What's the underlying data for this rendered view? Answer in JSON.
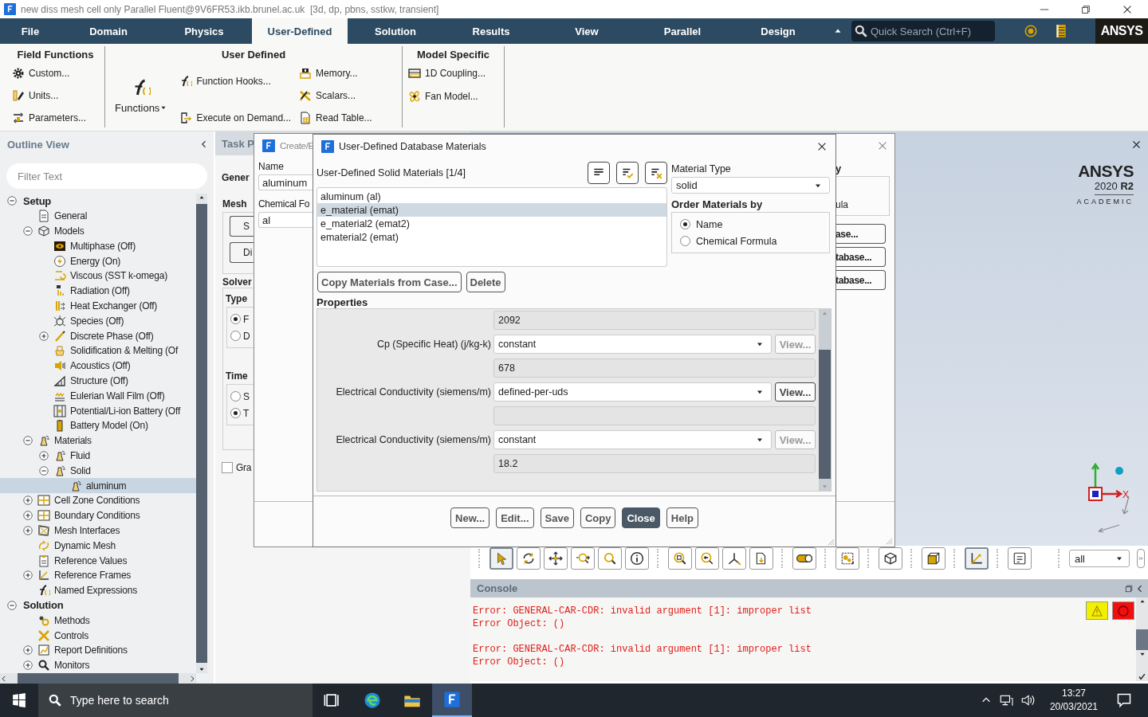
{
  "window": {
    "title": "new diss mesh cell only Parallel Fluent@9V6FR53.ikb.brunel.ac.uk  [3d, dp, pbns, sstkw, transient]"
  },
  "ribbon_tabs": [
    {
      "label": "File",
      "selected": false
    },
    {
      "label": "Domain",
      "selected": false
    },
    {
      "label": "Physics",
      "selected": false
    },
    {
      "label": "User-Defined",
      "selected": true
    },
    {
      "label": "Solution",
      "selected": false
    },
    {
      "label": "Results",
      "selected": false
    },
    {
      "label": "View",
      "selected": false
    },
    {
      "label": "Parallel",
      "selected": false
    },
    {
      "label": "Design",
      "selected": false
    }
  ],
  "quick_search": {
    "placeholder": "Quick Search (Ctrl+F)"
  },
  "brand": "ANSYS",
  "ribbon_groups": [
    {
      "title": "Field Functions",
      "columns": [
        [
          {
            "kind": "small",
            "label": "Custom..."
          },
          {
            "kind": "small",
            "label": "Units..."
          },
          {
            "kind": "small",
            "label": "Parameters..."
          }
        ]
      ]
    },
    {
      "title": "User Defined",
      "columns": [
        [
          {
            "kind": "large",
            "label": "Functions"
          }
        ],
        [
          {
            "kind": "small",
            "label": "Function Hooks..."
          },
          {
            "kind": "small",
            "label": "Execute on Demand..."
          }
        ],
        [
          {
            "kind": "small",
            "label": "Memory..."
          },
          {
            "kind": "small",
            "label": "Scalars..."
          },
          {
            "kind": "small",
            "label": "Read Table..."
          }
        ]
      ]
    },
    {
      "title": "Model Specific",
      "columns": [
        [
          {
            "kind": "small",
            "label": "1D Coupling..."
          },
          {
            "kind": "small",
            "label": "Fan Model..."
          }
        ]
      ]
    }
  ],
  "outline": {
    "title": "Outline View",
    "filter_placeholder": "Filter Text",
    "tree": [
      {
        "label": "Setup",
        "expanded": true,
        "selected": false,
        "children": [
          {
            "label": "General",
            "selected": false
          },
          {
            "label": "Models",
            "expanded": true,
            "selected": false,
            "children": [
              {
                "label": "Multiphase (Off)",
                "selected": false
              },
              {
                "label": "Energy (On)",
                "selected": false
              },
              {
                "label": "Viscous (SST k-omega)",
                "selected": false
              },
              {
                "label": "Radiation (Off)",
                "selected": false
              },
              {
                "label": "Heat Exchanger (Off)",
                "selected": false
              },
              {
                "label": "Species (Off)",
                "selected": false
              },
              {
                "label": "Discrete Phase (Off)",
                "expanded": false,
                "selected": false
              },
              {
                "label": "Solidification & Melting (Of",
                "selected": false
              },
              {
                "label": "Acoustics (Off)",
                "selected": false
              },
              {
                "label": "Structure (Off)",
                "selected": false
              },
              {
                "label": "Eulerian Wall Film (Off)",
                "selected": false
              },
              {
                "label": "Potential/Li-ion Battery (Off",
                "selected": false
              },
              {
                "label": "Battery Model (On)",
                "selected": false
              }
            ]
          },
          {
            "label": "Materials",
            "expanded": true,
            "selected": false,
            "children": [
              {
                "label": "Fluid",
                "expanded": false,
                "selected": false
              },
              {
                "label": "Solid",
                "expanded": true,
                "selected": false,
                "children": [
                  {
                    "label": "aluminum",
                    "selected": true
                  }
                ]
              }
            ]
          },
          {
            "label": "Cell Zone Conditions",
            "expanded": false,
            "selected": false
          },
          {
            "label": "Boundary Conditions",
            "expanded": false,
            "selected": false
          },
          {
            "label": "Mesh Interfaces",
            "expanded": false,
            "selected": false
          },
          {
            "label": "Dynamic Mesh",
            "selected": false
          },
          {
            "label": "Reference Values",
            "selected": false
          },
          {
            "label": "Reference Frames",
            "expanded": false,
            "selected": false
          },
          {
            "label": "Named Expressions",
            "selected": false
          }
        ]
      },
      {
        "label": "Solution",
        "expanded": true,
        "selected": false,
        "children": [
          {
            "label": "Methods",
            "selected": false
          },
          {
            "label": "Controls",
            "selected": false
          },
          {
            "label": "Report Definitions",
            "expanded": false,
            "selected": false
          },
          {
            "label": "Monitors",
            "expanded": false,
            "selected": false
          }
        ]
      }
    ]
  },
  "task_page": {
    "title": "Task P",
    "general": "Gener",
    "mesh": {
      "label": "Mesh",
      "buttons": [
        "S",
        "Di"
      ]
    },
    "solver": {
      "label": "Solver",
      "type": {
        "label": "Type",
        "options": [
          {
            "label": "F",
            "selected": true
          },
          {
            "label": "D",
            "selected": false
          }
        ]
      },
      "time": {
        "label": "Time",
        "options": [
          {
            "label": "S",
            "selected": false
          },
          {
            "label": "T",
            "selected": true
          }
        ]
      }
    },
    "gravity": {
      "label": "Gra",
      "checked": false
    }
  },
  "edit_dialog": {
    "title": "Create/E",
    "name_label": "Name",
    "name_value": "aluminum",
    "formula_label": "Chemical Fo",
    "formula_value": "al",
    "order_label": "y",
    "order_option": "ula",
    "buttons": [
      "ase...",
      "tabase...",
      "tabase..."
    ]
  },
  "database_dialog": {
    "title": "User-Defined Database Materials",
    "list_label": "User-Defined Solid Materials [1/4]",
    "materials": [
      {
        "label": "aluminum (al)",
        "selected": false
      },
      {
        "label": "e_material (emat)",
        "selected": true
      },
      {
        "label": "e_material2 (emat2)",
        "selected": false
      },
      {
        "label": "ematerial2 (emat)",
        "selected": false
      }
    ],
    "material_type": {
      "label": "Material Type",
      "value": "solid"
    },
    "order_by": {
      "label": "Order Materials by",
      "options": [
        {
          "label": "Name",
          "selected": true
        },
        {
          "label": "Chemical Formula",
          "selected": false
        }
      ]
    },
    "list_buttons": [
      "Copy Materials from Case...",
      "Delete"
    ],
    "properties_label": "Properties",
    "properties": [
      {
        "kind": "value",
        "value": "2092"
      },
      {
        "kind": "method",
        "label": "Cp (Specific Heat) (j/kg-k)",
        "value": "constant",
        "button": "View...",
        "disabled": true
      },
      {
        "kind": "value",
        "value": "678"
      },
      {
        "kind": "method",
        "label": "Electrical Conductivity (siemens/m)",
        "value": "defined-per-uds",
        "button": "View...",
        "disabled": false
      },
      {
        "kind": "value"
      },
      {
        "kind": "method",
        "label": "Electrical Conductivity (siemens/m)",
        "value": "constant",
        "button": "View...",
        "disabled": true
      },
      {
        "kind": "value",
        "value": "18.2"
      }
    ],
    "buttons": [
      {
        "label": "New...",
        "default": false
      },
      {
        "label": "Edit...",
        "default": false
      },
      {
        "label": "Save",
        "default": false
      },
      {
        "label": "Copy",
        "default": false
      },
      {
        "label": "Close",
        "default": true
      },
      {
        "label": "Help",
        "default": false
      }
    ]
  },
  "graphics": {
    "logo": "ANSYS",
    "version": "2020 **R2**",
    "edition": "ACADEMIC",
    "axis_label": "X"
  },
  "graphics_toolbar": {
    "buttons": [
      {
        "selected": true
      },
      {
        "selected": false
      },
      {
        "selected": false
      },
      {
        "selected": false
      },
      {
        "selected": false
      },
      {
        "selected": false
      },
      {
        "selected": false
      },
      {
        "selected": false
      },
      {
        "selected": false
      },
      {
        "selected": false
      },
      {
        "selected": false
      },
      {
        "selected": false
      },
      {
        "selected": false
      },
      {
        "selected": false
      },
      {
        "selected": true
      },
      {
        "selected": false
      }
    ],
    "view_select": "all"
  },
  "console": {
    "title": "Console",
    "messages": [
      [
        "Error: GENERAL-CAR-CDR: invalid argument [1]: improper list",
        "Error Object: ()"
      ],
      [
        "Error: GENERAL-CAR-CDR: invalid argument [1]: improper list",
        "Error Object: ()"
      ]
    ]
  },
  "taskbar": {
    "search_placeholder": "Type here to search",
    "apps": [
      {
        "selected": false
      },
      {
        "selected": false
      },
      {
        "selected": false
      },
      {
        "selected": true
      }
    ],
    "time": "13:27",
    "date": "20/03/2021"
  }
}
